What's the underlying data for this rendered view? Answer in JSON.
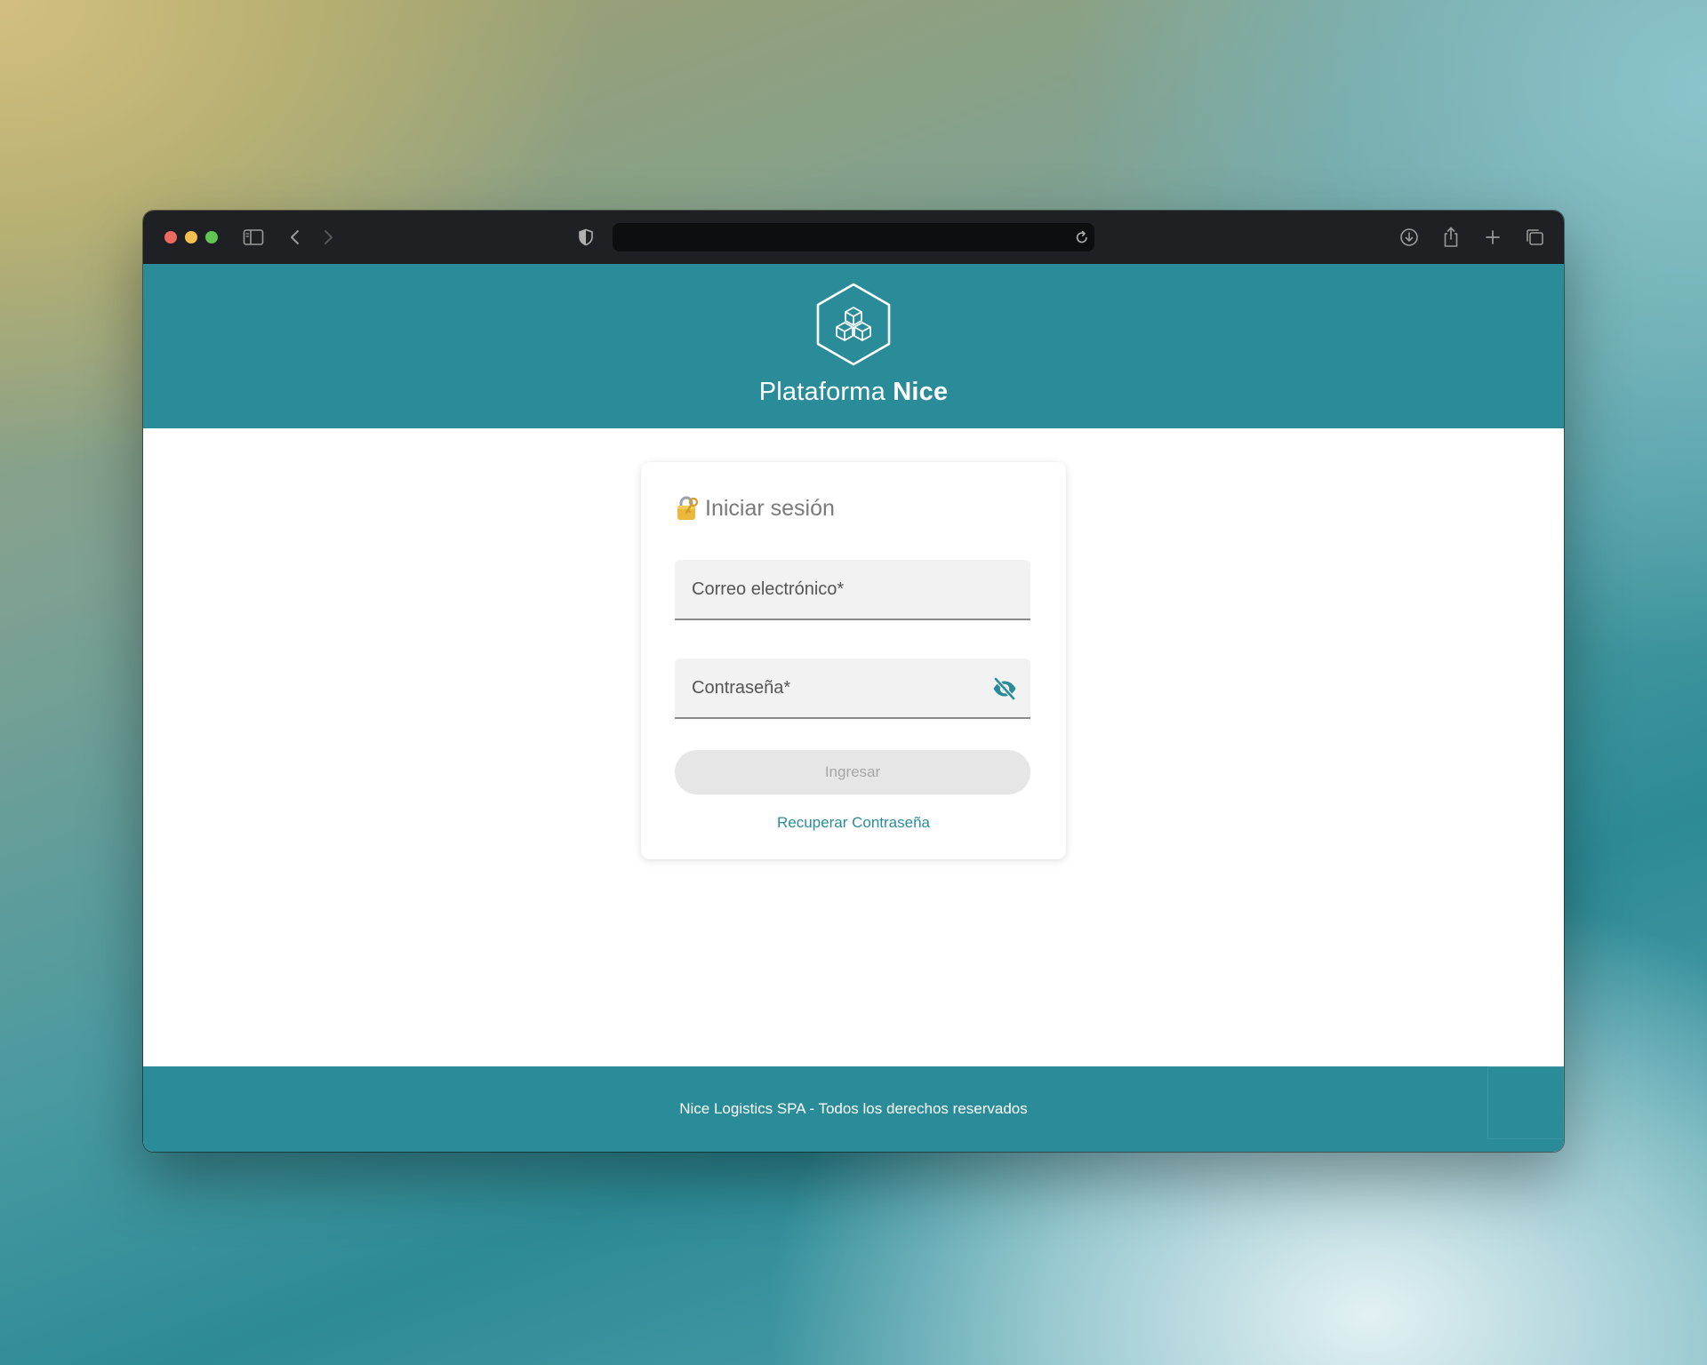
{
  "browser": {
    "url_value": "",
    "icons": [
      "sidebar-icon",
      "back-icon",
      "forward-icon",
      "shield-icon",
      "reload-icon",
      "download-icon",
      "share-icon",
      "new-tab-icon",
      "tabs-overview-icon"
    ]
  },
  "header": {
    "brand_regular": "Plataforma ",
    "brand_bold": "Nice",
    "logo_icon": "hexagon-boxes-logo"
  },
  "login": {
    "title": "Iniciar sesión",
    "email_placeholder": "Correo electrónico*",
    "password_placeholder": "Contraseña*",
    "submit_label": "Ingresar",
    "recover_label": "Recuperar Contraseña"
  },
  "footer": {
    "text": "Nice Logistics SPA - Todos los derechos reservados"
  },
  "colors": {
    "brand_teal": "#2b8c99",
    "toolbar": "#1f2023",
    "button_disabled_bg": "#e6e6e6",
    "button_disabled_text": "#a6a6a6"
  }
}
